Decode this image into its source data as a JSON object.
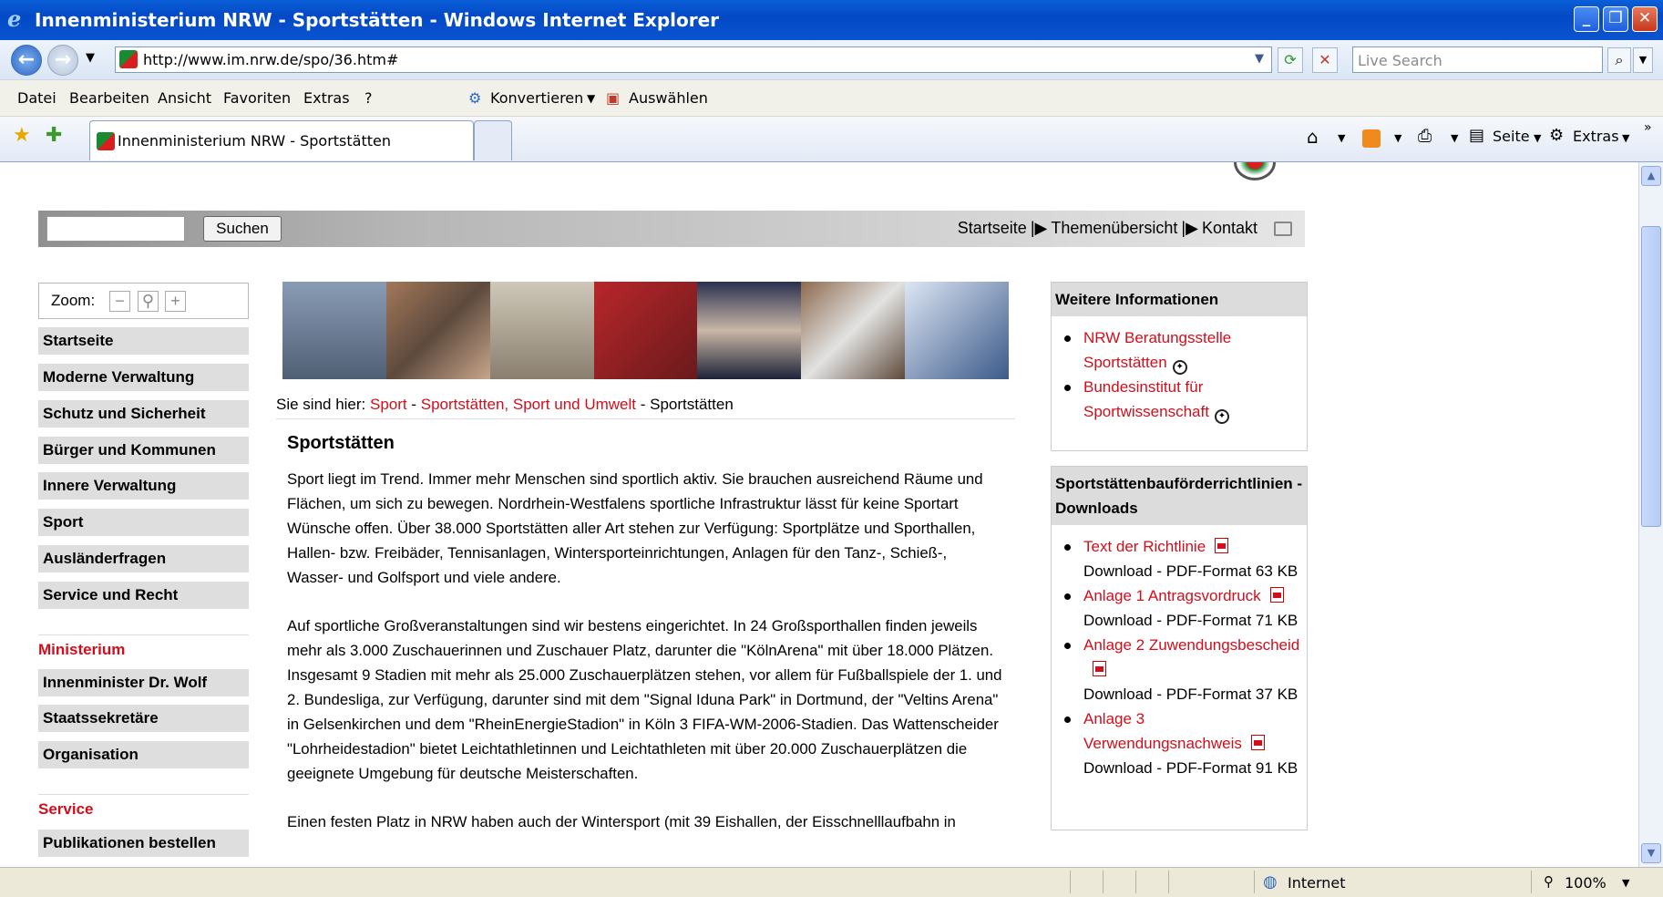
{
  "window": {
    "title": "Innenministerium NRW - Sportstätten - Windows Internet Explorer"
  },
  "address": {
    "url": "http://www.im.nrw.de/spo/36.htm#",
    "search_placeholder": "Live Search"
  },
  "menu": {
    "items": [
      "Datei",
      "Bearbeiten",
      "Ansicht",
      "Favoriten",
      "Extras",
      "?"
    ],
    "convert": "Konvertieren",
    "select": "Auswählen"
  },
  "tabs": {
    "active": "Innenministerium NRW - Sportstätten"
  },
  "toolbar": {
    "page": "Seite",
    "extras": "Extras"
  },
  "page": {
    "search_button": "Suchen",
    "toplinks": [
      "Startseite",
      "Themenübersicht",
      "Kontakt"
    ],
    "zoom_label": "Zoom:",
    "nav_main": [
      "Startseite",
      "Moderne Verwaltung",
      "Schutz und Sicherheit",
      "Bürger und Kommunen",
      "Innere Verwaltung",
      "Sport",
      "Ausländerfragen",
      "Service und Recht"
    ],
    "nav_ministerium_head": "Ministerium",
    "nav_ministerium": [
      "Innenminister Dr. Wolf",
      "Staatssekretäre",
      "Organisation"
    ],
    "nav_service_head": "Service",
    "nav_service": [
      "Publikationen bestellen"
    ],
    "breadcrumb": {
      "prefix": "Sie sind hier:",
      "links": [
        "Sport",
        "Sportstätten, Sport und Umwelt"
      ],
      "current": "Sportstätten"
    },
    "article": {
      "title": "Sportstätten",
      "paragraphs": [
        "Sport liegt im Trend. Immer mehr Menschen sind sportlich aktiv. Sie brauchen ausreichend Räume und Flächen, um sich zu bewegen. Nordrhein-Westfalens sportliche Infrastruktur lässt für keine Sportart Wünsche offen. Über 38.000 Sportstätten aller Art stehen zur Verfügung: Sportplätze und Sporthallen, Hallen- bzw. Freibäder, Tennisanlagen, Wintersporteinrichtungen, Anlagen für den Tanz-, Schieß-, Wasser- und Golfsport und viele andere.",
        "Auf sportliche Großveranstaltungen sind wir bestens eingerichtet. In 24 Großsporthallen finden jeweils mehr als 3.000 Zuschauerinnen und Zuschauer Platz, darunter die \"KölnArena\" mit über 18.000 Plätzen. Insgesamt 9 Stadien mit mehr als 25.000 Zuschauerplätzen stehen, vor allem für Fußballspiele der 1. und 2. Bundesliga, zur Verfügung, darunter sind mit dem \"Signal Iduna Park\" in Dortmund, der \"Veltins Arena\" in Gelsenkirchen und dem \"RheinEnergieStadion\" in Köln 3 FIFA-WM-2006-Stadien. Das Wattenscheider \"Lohrheidestadion\" bietet Leichtathletinnen und Leichtathleten mit über 20.000 Zuschauerplätzen die geeignete Umgebung für deutsche Meisterschaften.",
        "Einen festen Platz in NRW haben auch der Wintersport (mit 39 Eishallen, der Eisschnelllaufbahn in"
      ]
    },
    "info_box": {
      "title": "Weitere Informationen",
      "links": [
        "NRW Beratungsstelle Sportstätten",
        "Bundesinstitut für Sportwissenschaft"
      ]
    },
    "downloads_box": {
      "title": "Sportstättenbauförderrichtlinien - Downloads",
      "items": [
        {
          "label": "Text der Richtlinie",
          "info": "Download - PDF-Format 63 KB"
        },
        {
          "label": "Anlage 1 Antragsvordruck",
          "info": "Download - PDF-Format 71 KB"
        },
        {
          "label": "Anlage 2 Zuwendungsbescheid",
          "info": "Download - PDF-Format 37 KB"
        },
        {
          "label": "Anlage 3 Verwendungsnachweis",
          "info": "Download - PDF-Format 91 KB"
        }
      ]
    }
  },
  "status": {
    "zone": "Internet",
    "zoom": "100%"
  },
  "colors": {
    "link": "#d10f1c",
    "titlebar": "#0a5fd8"
  }
}
